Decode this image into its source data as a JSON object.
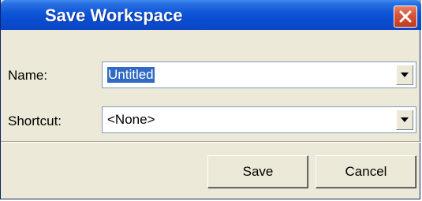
{
  "window": {
    "title": "Save Workspace"
  },
  "form": {
    "name_label": "Name:",
    "name_value": "Untitled",
    "shortcut_label": "Shortcut:",
    "shortcut_value": "<None>"
  },
  "buttons": {
    "save_label": "Save",
    "cancel_label": "Cancel"
  },
  "icons": {
    "close": "close-icon",
    "dropdown": "chevron-down-icon"
  },
  "colors": {
    "titlebar": "#0a4bd0",
    "close": "#d9563a",
    "selection": "#316ac5",
    "dialog_bg": "#ece9d8"
  }
}
